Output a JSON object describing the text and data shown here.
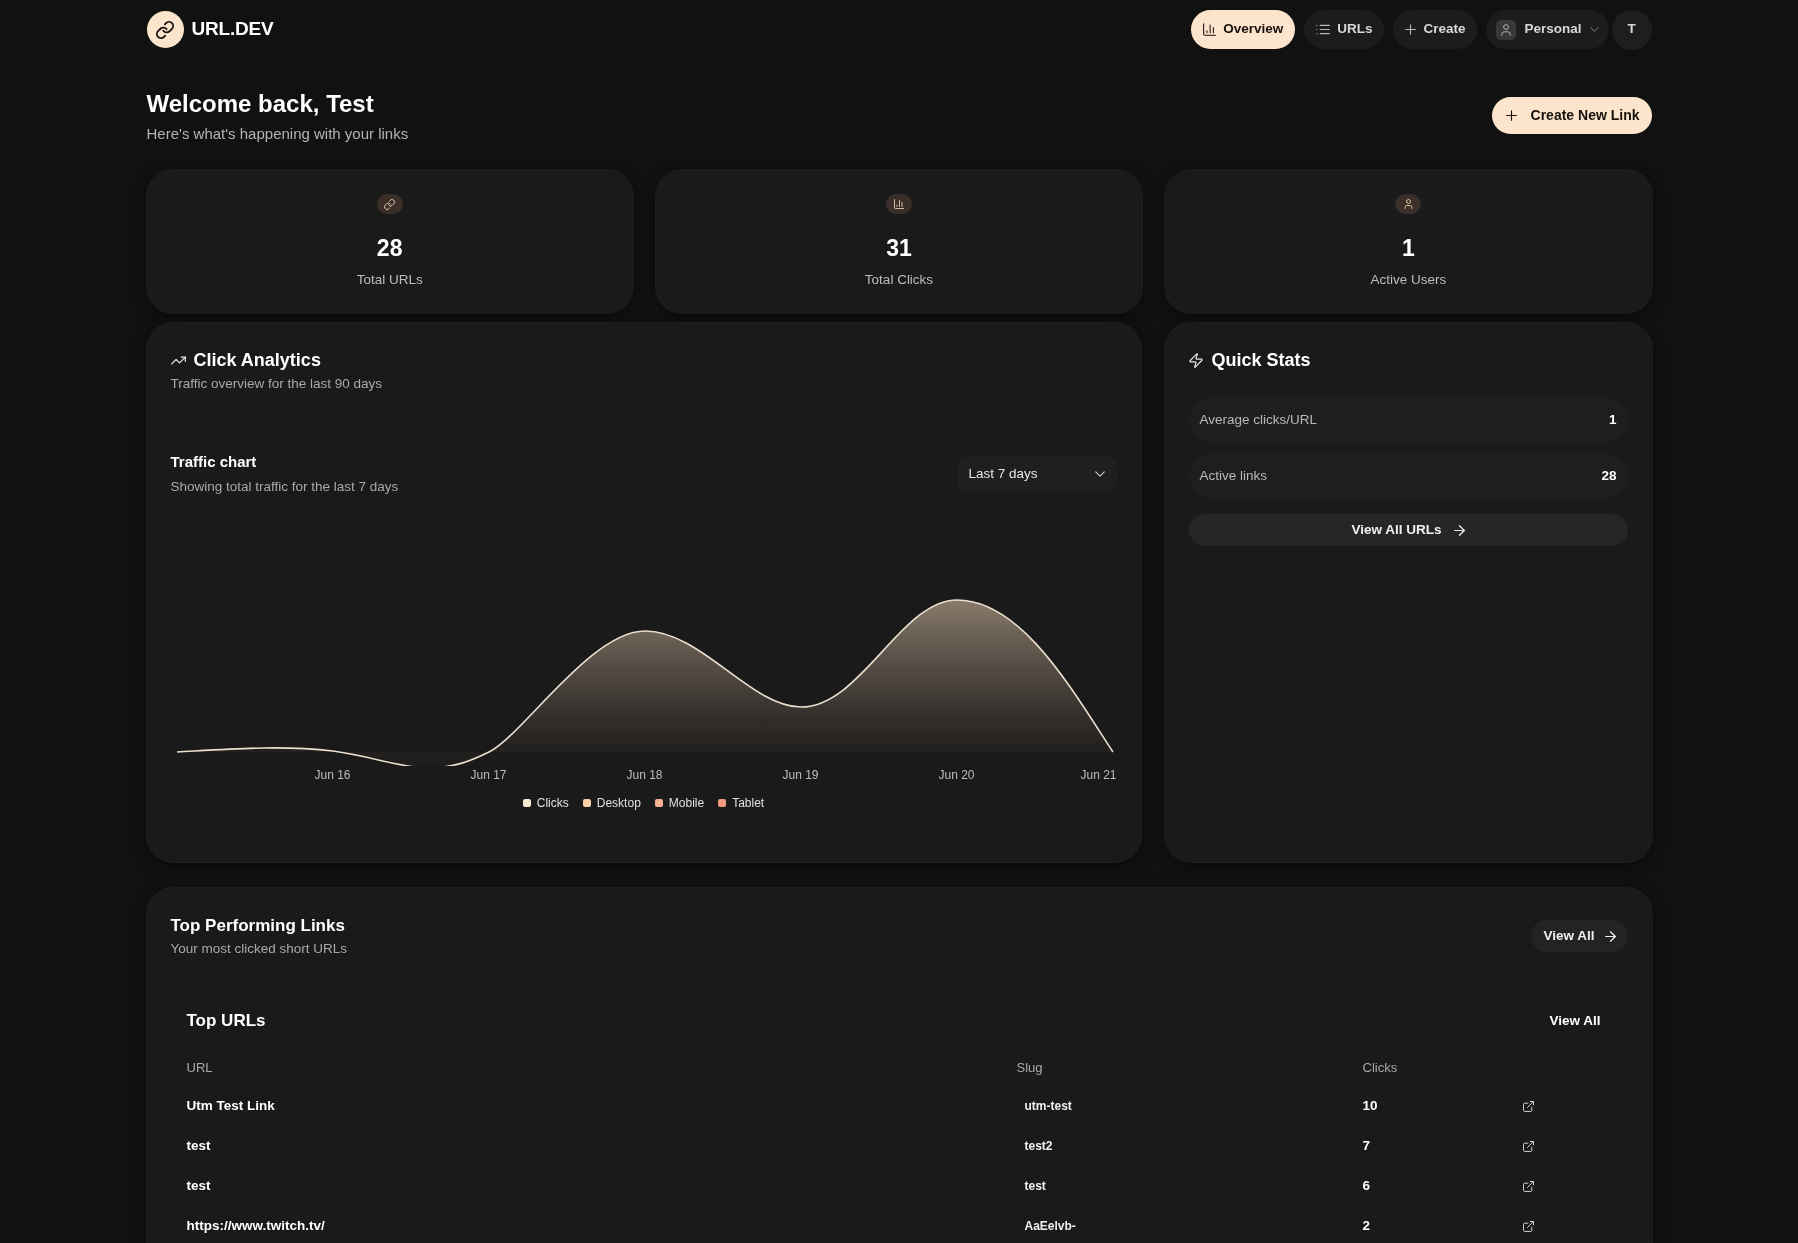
{
  "header": {
    "brand": "URL.DEV",
    "nav": [
      {
        "label": "Overview",
        "selected": true
      },
      {
        "label": "URLs",
        "selected": false
      },
      {
        "label": "Create",
        "selected": false
      }
    ],
    "workspace": {
      "label": "Personal"
    },
    "avatar": {
      "initial": "T"
    }
  },
  "welcome": {
    "title": "Welcome back, Test",
    "subtitle": "Here's what's happening with your links",
    "create_button": "Create New Link"
  },
  "stats": [
    {
      "value": "28",
      "label": "Total URLs"
    },
    {
      "value": "31",
      "label": "Total Clicks"
    },
    {
      "value": "1",
      "label": "Active Users"
    }
  ],
  "click_analytics": {
    "title": "Click Analytics",
    "subtitle": "Traffic overview for the last 90 days",
    "traffic_chart": {
      "title": "Traffic chart",
      "subtitle": "Showing total traffic for the last 7 days",
      "range_select": {
        "value": "Last 7 days"
      },
      "x_labels": [
        "Jun 16",
        "Jun 17",
        "Jun 18",
        "Jun 19",
        "Jun 20",
        "Jun 21"
      ],
      "legend": [
        {
          "label": "Clicks",
          "color": "#fbe8d5"
        },
        {
          "label": "Desktop",
          "color": "#fccfa5"
        },
        {
          "label": "Mobile",
          "color": "#f8b193"
        },
        {
          "label": "Tablet",
          "color": "#f39a7e"
        }
      ]
    }
  },
  "quick_stats": {
    "title": "Quick Stats",
    "rows": [
      {
        "label": "Average clicks/URL",
        "value": "1"
      },
      {
        "label": "Active links",
        "value": "28"
      }
    ],
    "button": "View All URLs"
  },
  "top_links": {
    "title": "Top Performing Links",
    "subtitle": "Your most clicked short URLs",
    "view_all_button": "View All",
    "table": {
      "title": "Top URLs",
      "view_all_link": "View All",
      "columns": [
        "URL",
        "Slug",
        "Clicks"
      ],
      "rows": [
        {
          "url": "Utm Test Link",
          "slug": "utm-test",
          "clicks": "10"
        },
        {
          "url": "test",
          "slug": "test2",
          "clicks": "7"
        },
        {
          "url": "test",
          "slug": "test",
          "clicks": "6"
        },
        {
          "url": "https://www.twitch.tv/",
          "slug": "AaEelvb-",
          "clicks": "2"
        }
      ]
    }
  }
}
